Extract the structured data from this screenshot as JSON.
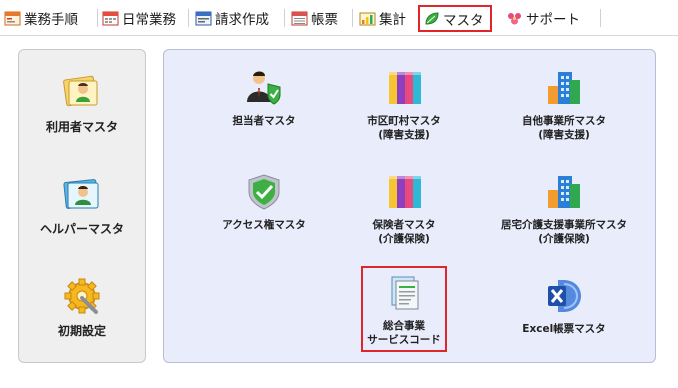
{
  "tabs": [
    {
      "label": "業務手順",
      "icon": "document-flow-icon"
    },
    {
      "label": "日常業務",
      "icon": "calendar-icon"
    },
    {
      "label": "請求作成",
      "icon": "invoice-icon"
    },
    {
      "label": "帳票",
      "icon": "report-icon"
    },
    {
      "label": "集計",
      "icon": "aggregate-icon"
    },
    {
      "label": "マスタ",
      "icon": "master-leaf-icon",
      "active": true
    },
    {
      "label": "サポート",
      "icon": "support-icon"
    }
  ],
  "left_panel": {
    "items": [
      {
        "label": "利用者マスタ",
        "icon": "user-card-icon"
      },
      {
        "label": "ヘルパーマスタ",
        "icon": "helper-card-icon"
      },
      {
        "label": "初期設定",
        "icon": "gear-wrench-icon"
      }
    ]
  },
  "right_panel": {
    "items": [
      {
        "line1": "担当者マスタ",
        "line2": "",
        "icon": "person-shield-icon"
      },
      {
        "line1": "市区町村マスタ",
        "line2": "(障害支援)",
        "icon": "color-books-icon"
      },
      {
        "line1": "自他事業所マスタ",
        "line2": "(障害支援)",
        "icon": "buildings-icon"
      },
      {
        "line1": "アクセス権マスタ",
        "line2": "",
        "icon": "shield-check-icon"
      },
      {
        "line1": "保険者マスタ",
        "line2": "(介護保険)",
        "icon": "color-books-icon"
      },
      {
        "line1": "居宅介護支援事業所マスタ",
        "line2": "(介護保険)",
        "icon": "buildings-icon"
      },
      {
        "line1": "総合事業",
        "line2": "サービスコード",
        "icon": "documents-stack-icon",
        "highlighted": true
      },
      {
        "line1": "Excel帳票マスタ",
        "line2": "",
        "icon": "excel-icon"
      }
    ]
  },
  "colors": {
    "highlight": "#e0262b",
    "panel_blue": "#e9ecfb",
    "panel_gray": "#efefef"
  }
}
